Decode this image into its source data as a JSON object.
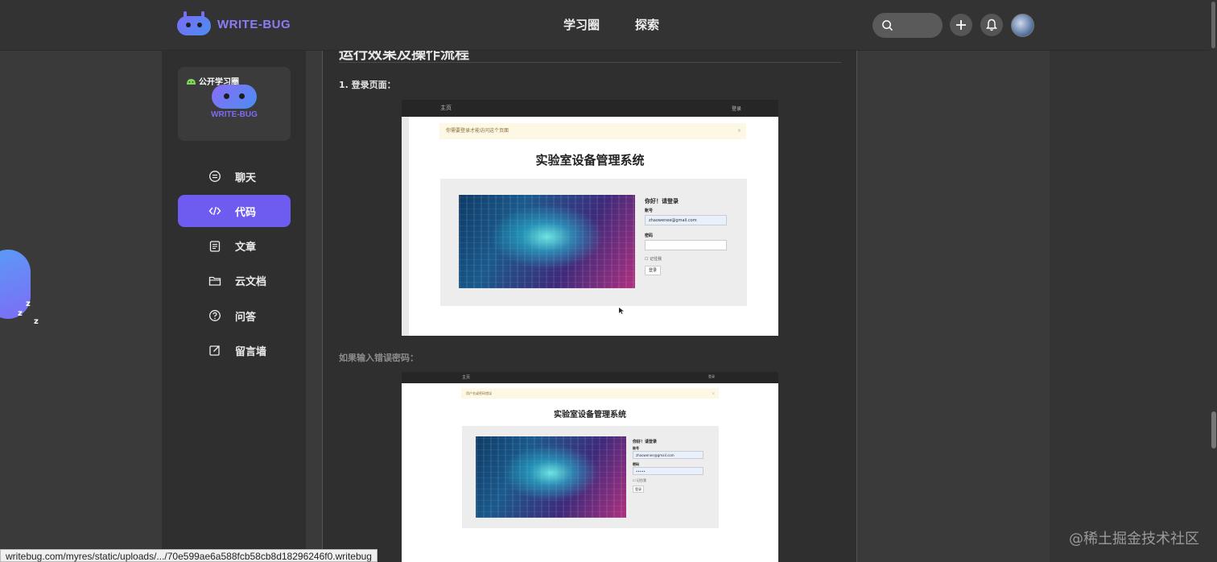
{
  "header": {
    "logo_text": "WRITE-BUG",
    "nav": [
      "学习圈",
      "探索"
    ],
    "icons": [
      "search-icon",
      "plus-icon",
      "bell-icon",
      "avatar"
    ]
  },
  "sidebar": {
    "group_tag": "公开学习圈",
    "group_name": "WRITE-BUG",
    "items": [
      {
        "label": "聊天",
        "icon": "chat-icon",
        "active": false
      },
      {
        "label": "代码",
        "icon": "code-icon",
        "active": true
      },
      {
        "label": "文章",
        "icon": "article-icon",
        "active": false
      },
      {
        "label": "云文档",
        "icon": "folder-icon",
        "active": false
      },
      {
        "label": "问答",
        "icon": "question-icon",
        "active": false
      },
      {
        "label": "留言墙",
        "icon": "edit-icon",
        "active": false
      }
    ],
    "accent": "#6e5cf0"
  },
  "content": {
    "section_title": "运行效果及操作流程",
    "step1_label": "1. 登录页面：",
    "step2_label": "如果输入错误密码：",
    "screenshot1": {
      "bar_home": "主页",
      "bar_login": "登录",
      "alert": "你需要登录才能访问这个页面",
      "alert_close": "×",
      "title": "实验室设备管理系统",
      "greeting": "你好！请登录",
      "account_label": "账号",
      "account_value": "zhaowenee@gmail.com",
      "password_label": "密码",
      "remember": "记住我",
      "login_button": "登录"
    },
    "screenshot2": {
      "bar_home": "主页",
      "bar_login": "登录",
      "alert": "用户名或密码错误",
      "alert_close": "×",
      "title": "实验室设备管理系统",
      "greeting": "你好！请登录",
      "account_label": "账号",
      "account_value": "zhaowenee@gmail.com",
      "password_label": "密码",
      "password_value": "•••••",
      "remember": "记住我",
      "login_button": "登录"
    }
  },
  "mascot": {
    "z1": "z",
    "z2": "z",
    "z3": "z"
  },
  "status_url": "writebug.com/myres/static/uploads/.../70e599ae6a588fcb58cb8d18296246f0.writebug",
  "watermark": "@稀土掘金技术社区"
}
